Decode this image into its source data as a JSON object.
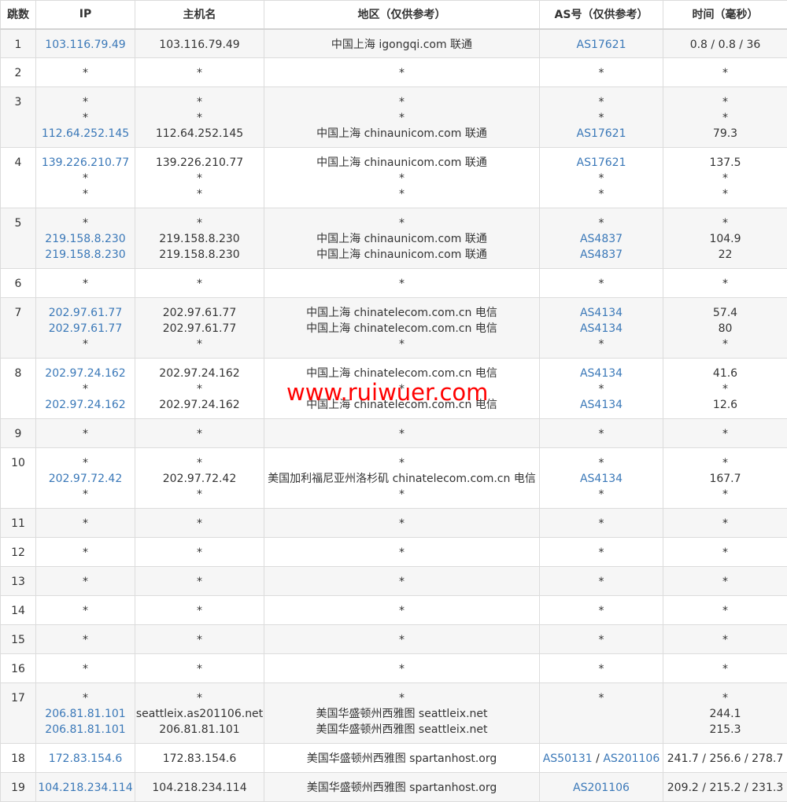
{
  "columns": [
    "跳数",
    "IP",
    "主机名",
    "地区（仅供参考）",
    "AS号（仅供参考）",
    "时间（毫秒）"
  ],
  "rows": [
    {
      "hop": "1",
      "ip": [
        "103.116.79.49"
      ],
      "host": [
        "103.116.79.49"
      ],
      "region": [
        "中国上海 igongqi.com 联通"
      ],
      "as": [
        [
          "AS17621"
        ]
      ],
      "time": [
        "0.8 / 0.8 / 36"
      ]
    },
    {
      "hop": "2",
      "ip": [
        "*"
      ],
      "host": [
        "*"
      ],
      "region": [
        "*"
      ],
      "as": [
        [
          "*"
        ]
      ],
      "time": [
        "*"
      ]
    },
    {
      "hop": "3",
      "ip": [
        "*",
        "*",
        "112.64.252.145"
      ],
      "host": [
        "*",
        "*",
        "112.64.252.145"
      ],
      "region": [
        "*",
        "*",
        "中国上海 chinaunicom.com 联通"
      ],
      "as": [
        [
          "*"
        ],
        [
          "*"
        ],
        [
          "AS17621"
        ]
      ],
      "time": [
        "*",
        "*",
        "79.3"
      ]
    },
    {
      "hop": "4",
      "ip": [
        "139.226.210.77",
        "*",
        "*"
      ],
      "host": [
        "139.226.210.77",
        "*",
        "*"
      ],
      "region": [
        "中国上海 chinaunicom.com 联通",
        "*",
        "*"
      ],
      "as": [
        [
          "AS17621"
        ],
        [
          "*"
        ],
        [
          "*"
        ]
      ],
      "time": [
        "137.5",
        "*",
        "*"
      ]
    },
    {
      "hop": "5",
      "ip": [
        "*",
        "219.158.8.230",
        "219.158.8.230"
      ],
      "host": [
        "*",
        "219.158.8.230",
        "219.158.8.230"
      ],
      "region": [
        "*",
        "中国上海 chinaunicom.com 联通",
        "中国上海 chinaunicom.com 联通"
      ],
      "as": [
        [
          "*"
        ],
        [
          "AS4837"
        ],
        [
          "AS4837"
        ]
      ],
      "time": [
        "*",
        "104.9",
        "22"
      ]
    },
    {
      "hop": "6",
      "ip": [
        "*"
      ],
      "host": [
        "*"
      ],
      "region": [
        "*"
      ],
      "as": [
        [
          "*"
        ]
      ],
      "time": [
        "*"
      ]
    },
    {
      "hop": "7",
      "ip": [
        "202.97.61.77",
        "202.97.61.77",
        "*"
      ],
      "host": [
        "202.97.61.77",
        "202.97.61.77",
        "*"
      ],
      "region": [
        "中国上海 chinatelecom.com.cn 电信",
        "中国上海 chinatelecom.com.cn 电信",
        "*"
      ],
      "as": [
        [
          "AS4134"
        ],
        [
          "AS4134"
        ],
        [
          "*"
        ]
      ],
      "time": [
        "57.4",
        "80",
        "*"
      ]
    },
    {
      "hop": "8",
      "ip": [
        "202.97.24.162",
        "*",
        "202.97.24.162"
      ],
      "host": [
        "202.97.24.162",
        "*",
        "202.97.24.162"
      ],
      "region": [
        "中国上海 chinatelecom.com.cn 电信",
        "*",
        "中国上海 chinatelecom.com.cn 电信"
      ],
      "as": [
        [
          "AS4134"
        ],
        [
          "*"
        ],
        [
          "AS4134"
        ]
      ],
      "time": [
        "41.6",
        "*",
        "12.6"
      ]
    },
    {
      "hop": "9",
      "ip": [
        "*"
      ],
      "host": [
        "*"
      ],
      "region": [
        "*"
      ],
      "as": [
        [
          "*"
        ]
      ],
      "time": [
        "*"
      ]
    },
    {
      "hop": "10",
      "ip": [
        "*",
        "202.97.72.42",
        "*"
      ],
      "host": [
        "*",
        "202.97.72.42",
        "*"
      ],
      "region": [
        "*",
        "美国加利福尼亚州洛杉矶 chinatelecom.com.cn 电信",
        "*"
      ],
      "as": [
        [
          "*"
        ],
        [
          "AS4134"
        ],
        [
          "*"
        ]
      ],
      "time": [
        "*",
        "167.7",
        "*"
      ]
    },
    {
      "hop": "11",
      "ip": [
        "*"
      ],
      "host": [
        "*"
      ],
      "region": [
        "*"
      ],
      "as": [
        [
          "*"
        ]
      ],
      "time": [
        "*"
      ]
    },
    {
      "hop": "12",
      "ip": [
        "*"
      ],
      "host": [
        "*"
      ],
      "region": [
        "*"
      ],
      "as": [
        [
          "*"
        ]
      ],
      "time": [
        "*"
      ]
    },
    {
      "hop": "13",
      "ip": [
        "*"
      ],
      "host": [
        "*"
      ],
      "region": [
        "*"
      ],
      "as": [
        [
          "*"
        ]
      ],
      "time": [
        "*"
      ]
    },
    {
      "hop": "14",
      "ip": [
        "*"
      ],
      "host": [
        "*"
      ],
      "region": [
        "*"
      ],
      "as": [
        [
          "*"
        ]
      ],
      "time": [
        "*"
      ]
    },
    {
      "hop": "15",
      "ip": [
        "*"
      ],
      "host": [
        "*"
      ],
      "region": [
        "*"
      ],
      "as": [
        [
          "*"
        ]
      ],
      "time": [
        "*"
      ]
    },
    {
      "hop": "16",
      "ip": [
        "*"
      ],
      "host": [
        "*"
      ],
      "region": [
        "*"
      ],
      "as": [
        [
          "*"
        ]
      ],
      "time": [
        "*"
      ]
    },
    {
      "hop": "17",
      "ip": [
        "*",
        "206.81.81.101",
        "206.81.81.101"
      ],
      "host": [
        "*",
        "seattleix.as201106.net",
        "206.81.81.101"
      ],
      "region": [
        "*",
        "美国华盛顿州西雅图 seattleix.net",
        "美国华盛顿州西雅图 seattleix.net"
      ],
      "as": [
        [
          "*"
        ],
        [],
        []
      ],
      "time": [
        "*",
        "244.1",
        "215.3"
      ]
    },
    {
      "hop": "18",
      "ip": [
        "172.83.154.6"
      ],
      "host": [
        "172.83.154.6"
      ],
      "region": [
        "美国华盛顿州西雅图 spartanhost.org"
      ],
      "as": [
        [
          "AS50131",
          "AS201106"
        ]
      ],
      "time": [
        "241.7 / 256.6 / 278.7"
      ]
    },
    {
      "hop": "19",
      "ip": [
        "104.218.234.114"
      ],
      "host": [
        "104.218.234.114"
      ],
      "region": [
        "美国华盛顿州西雅图 spartanhost.org"
      ],
      "as": [
        [
          "AS201106"
        ]
      ],
      "time": [
        "209.2 / 215.2 / 231.3"
      ]
    }
  ],
  "as_separator": " / ",
  "watermark": "www.ruiwuer.com",
  "colors": {
    "link": "#3a78b8",
    "watermark": "#ff0000",
    "stripe": "#f6f6f6"
  }
}
